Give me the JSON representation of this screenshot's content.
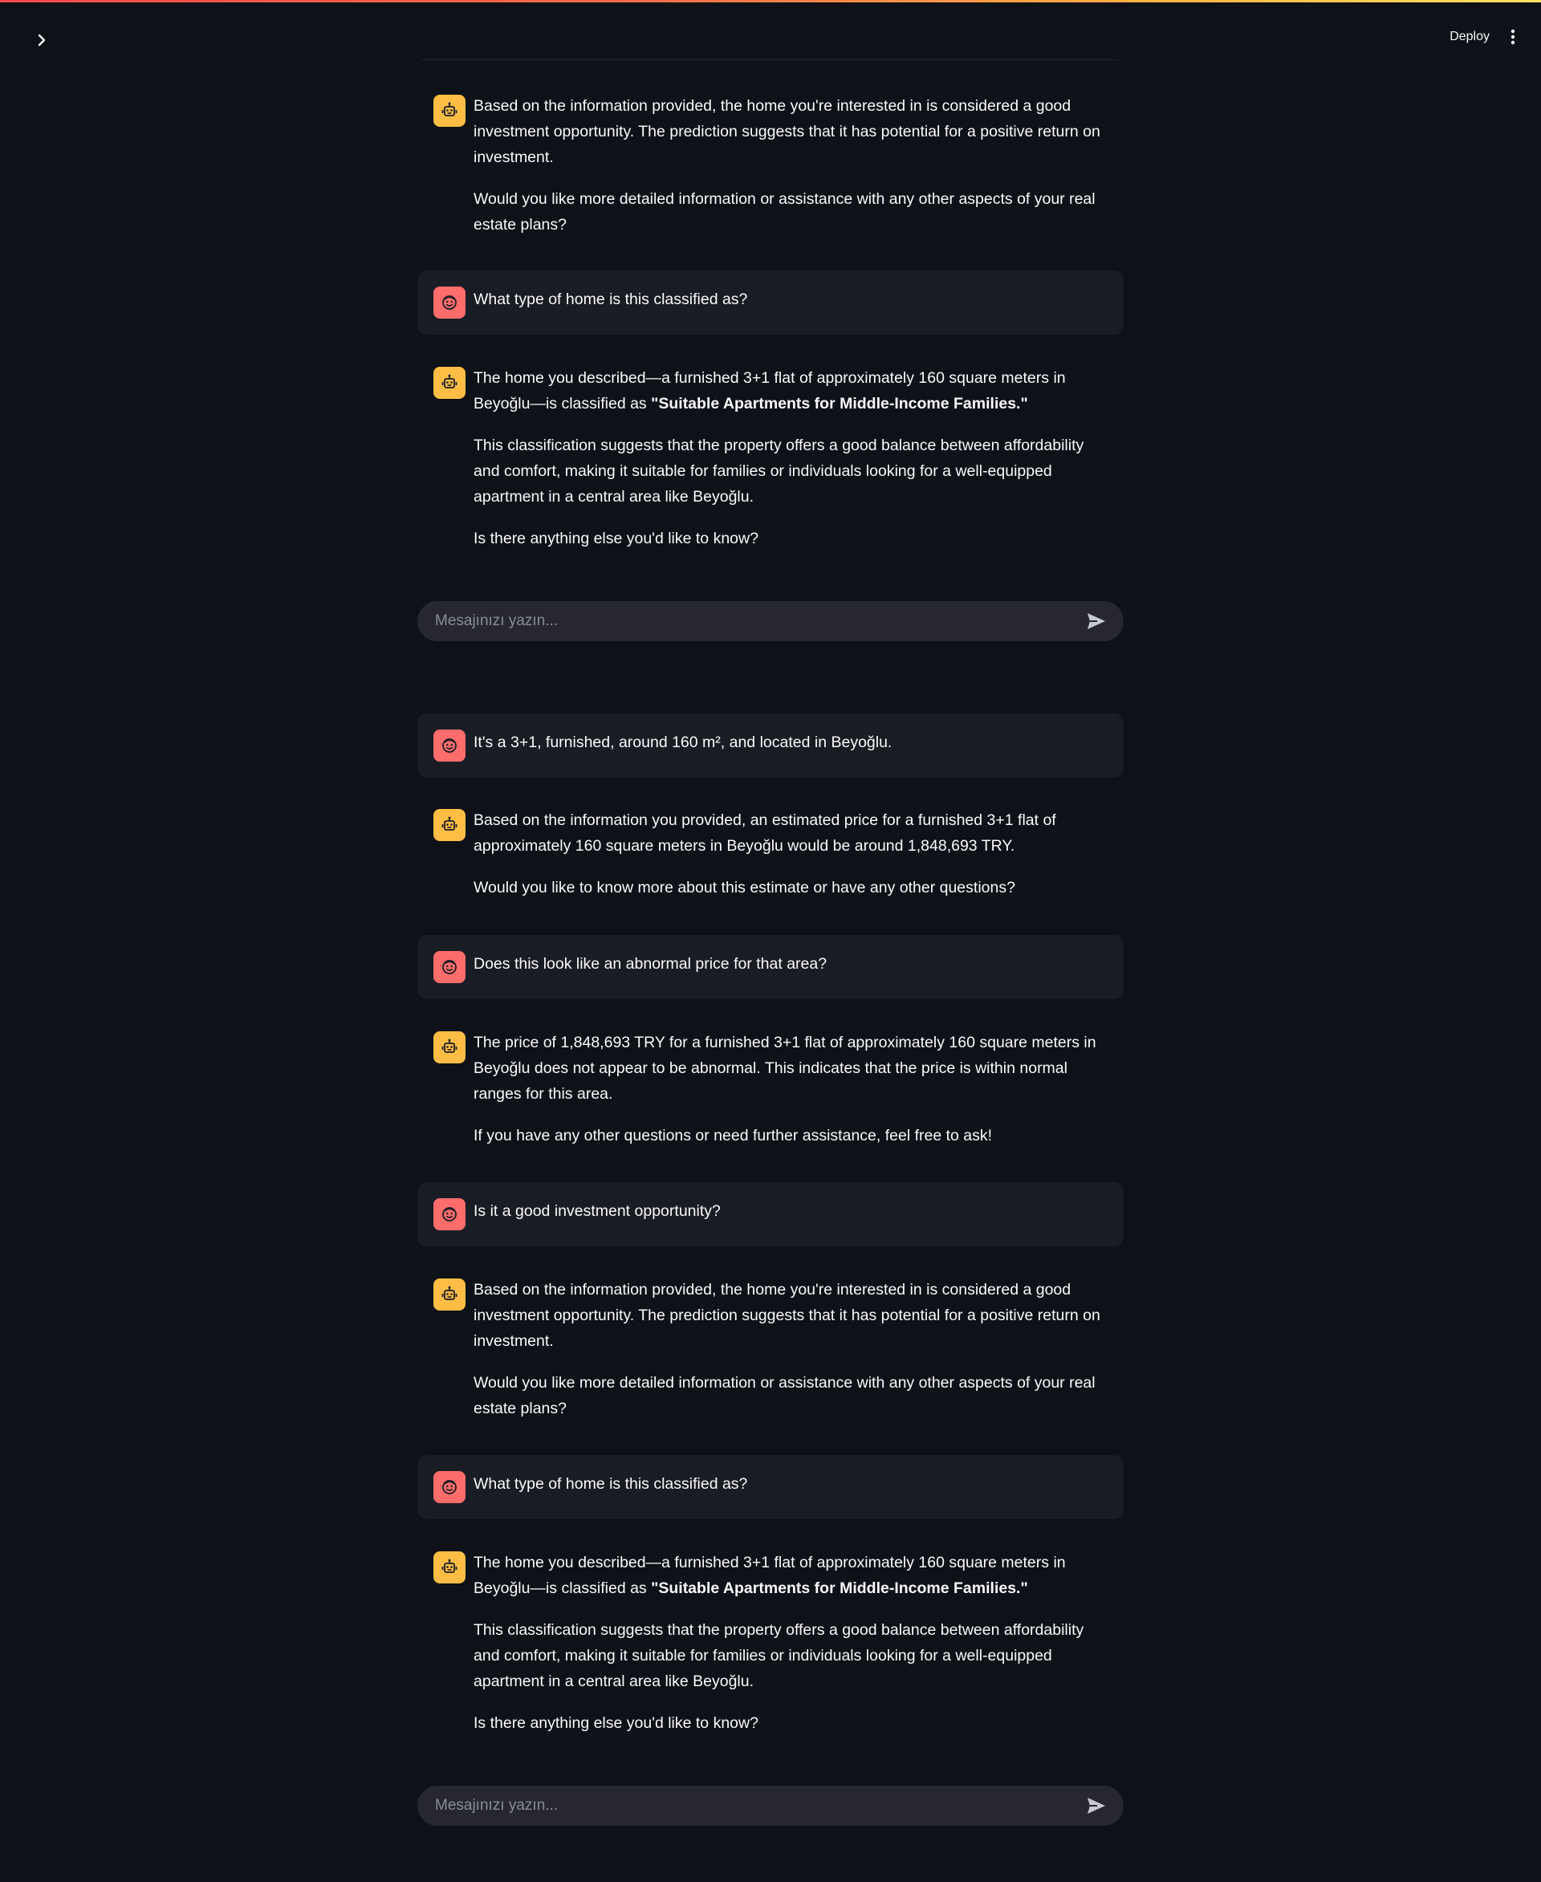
{
  "header": {
    "deploy_label": "Deploy"
  },
  "icons": {
    "sidebar_toggle": "chevron-right-icon",
    "menu": "vertical-dots-icon",
    "assistant_avatar": "robot-face-icon",
    "user_avatar": "smiling-face-icon",
    "send": "paper-plane-icon"
  },
  "colors": {
    "background": "#0e1117",
    "user_bubble": "#1a1c24",
    "input_background": "#262730",
    "assistant_avatar": "#ffbd45",
    "user_avatar": "#ff6c6c",
    "top_gradient_start": "#ff4b4b",
    "top_gradient_end": "#ffe066"
  },
  "chat_top": [
    {
      "role": "assistant",
      "paragraphs": [
        [
          "Based on the information provided, the home you're interested in is considered a good investment opportunity. The prediction suggests that it has potential for a positive return on investment."
        ],
        [
          "Would you like more detailed information or assistance with any other aspects of your real estate plans?"
        ]
      ]
    },
    {
      "role": "user",
      "paragraphs": [
        [
          "What type of home is this classified as?"
        ]
      ]
    },
    {
      "role": "assistant",
      "paragraphs": [
        [
          "The home you described—a furnished 3+1 flat of approximately 160 square meters in Beyoğlu—is classified as ",
          "\"Suitable Apartments for Middle-Income Families.\""
        ],
        [
          "This classification suggests that the property offers a good balance between affordability and comfort, making it suitable for families or individuals looking for a well-equipped apartment in a central area like Beyoğlu."
        ],
        [
          "Is there anything else you'd like to know?"
        ]
      ]
    }
  ],
  "input_top": {
    "placeholder": "Mesajınızı yazın...",
    "value": ""
  },
  "chat_bottom": [
    {
      "role": "user",
      "paragraphs": [
        [
          "It's a 3+1, furnished, around 160 m², and located in Beyoğlu."
        ]
      ]
    },
    {
      "role": "assistant",
      "paragraphs": [
        [
          "Based on the information you provided, an estimated price for a furnished 3+1 flat of approximately 160 square meters in Beyoğlu would be around 1,848,693 TRY."
        ],
        [
          "Would you like to know more about this estimate or have any other questions?"
        ]
      ]
    },
    {
      "role": "user",
      "paragraphs": [
        [
          "Does this look like an abnormal price for that area?"
        ]
      ]
    },
    {
      "role": "assistant",
      "paragraphs": [
        [
          "The price of 1,848,693 TRY for a furnished 3+1 flat of approximately 160 square meters in Beyoğlu does not appear to be abnormal. This indicates that the price is within normal ranges for this area."
        ],
        [
          "If you have any other questions or need further assistance, feel free to ask!"
        ]
      ]
    },
    {
      "role": "user",
      "paragraphs": [
        [
          "Is it a good investment opportunity?"
        ]
      ]
    },
    {
      "role": "assistant",
      "paragraphs": [
        [
          "Based on the information provided, the home you're interested in is considered a good investment opportunity. The prediction suggests that it has potential for a positive return on investment."
        ],
        [
          "Would you like more detailed information or assistance with any other aspects of your real estate plans?"
        ]
      ]
    },
    {
      "role": "user",
      "paragraphs": [
        [
          "What type of home is this classified as?"
        ]
      ]
    },
    {
      "role": "assistant",
      "paragraphs": [
        [
          "The home you described—a furnished 3+1 flat of approximately 160 square meters in Beyoğlu—is classified as ",
          "\"Suitable Apartments for Middle-Income Families.\""
        ],
        [
          "This classification suggests that the property offers a good balance between affordability and comfort, making it suitable for families or individuals looking for a well-equipped apartment in a central area like Beyoğlu."
        ],
        [
          "Is there anything else you'd like to know?"
        ]
      ]
    }
  ],
  "input_bottom": {
    "placeholder": "Mesajınızı yazın...",
    "value": ""
  }
}
